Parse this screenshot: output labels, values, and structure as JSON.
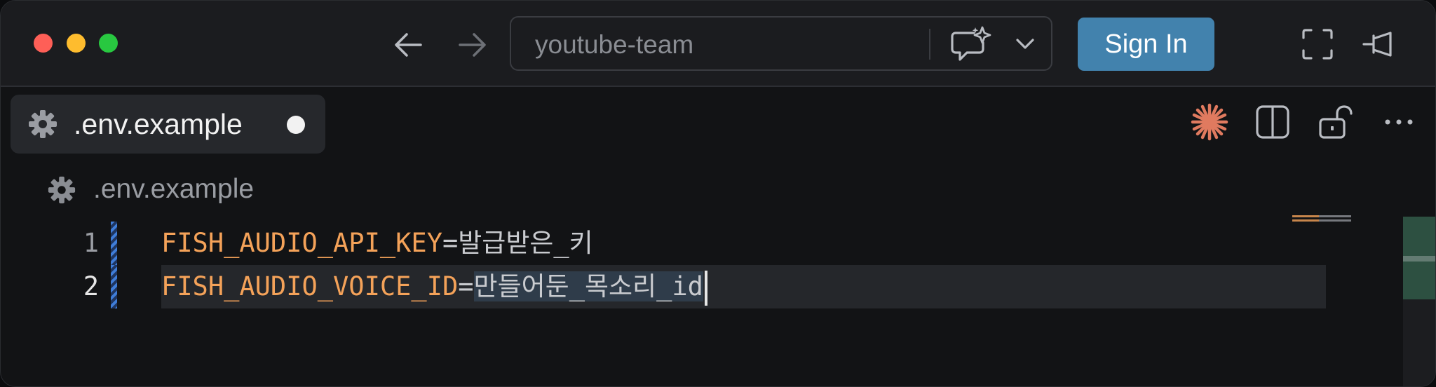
{
  "window": {
    "traffic_lights": [
      "close",
      "minimize",
      "maximize"
    ]
  },
  "toolbar": {
    "back_icon": "arrow-left-icon",
    "forward_icon": "arrow-right-icon",
    "command_center_text": "youtube-team",
    "chat_icon": "chat-sparkle-icon",
    "dropdown_icon": "chevron-down-icon",
    "sign_in_label": "Sign In",
    "fullscreen_icon": "fullscreen-icon",
    "pin_icon": "pin-icon"
  },
  "tab": {
    "icon": "gear-icon",
    "label": ".env.example",
    "modified": true
  },
  "editor_actions": {
    "icons": [
      "sparkle-icon",
      "split-editor-icon",
      "unlock-icon",
      "more-icon"
    ]
  },
  "breadcrumb": {
    "icon": "gear-icon",
    "label": ".env.example"
  },
  "lines": [
    {
      "number": "1",
      "key": "FISH_AUDIO_API_KEY",
      "eq": "=",
      "value": "발급받은_키"
    },
    {
      "number": "2",
      "key": "FISH_AUDIO_VOICE_ID",
      "eq": "=",
      "value": "만들어둔_목소리_id"
    }
  ],
  "colors": {
    "key": "#f4a259",
    "sign_in": "#4282ad",
    "sparkle": "#e07a5f"
  }
}
